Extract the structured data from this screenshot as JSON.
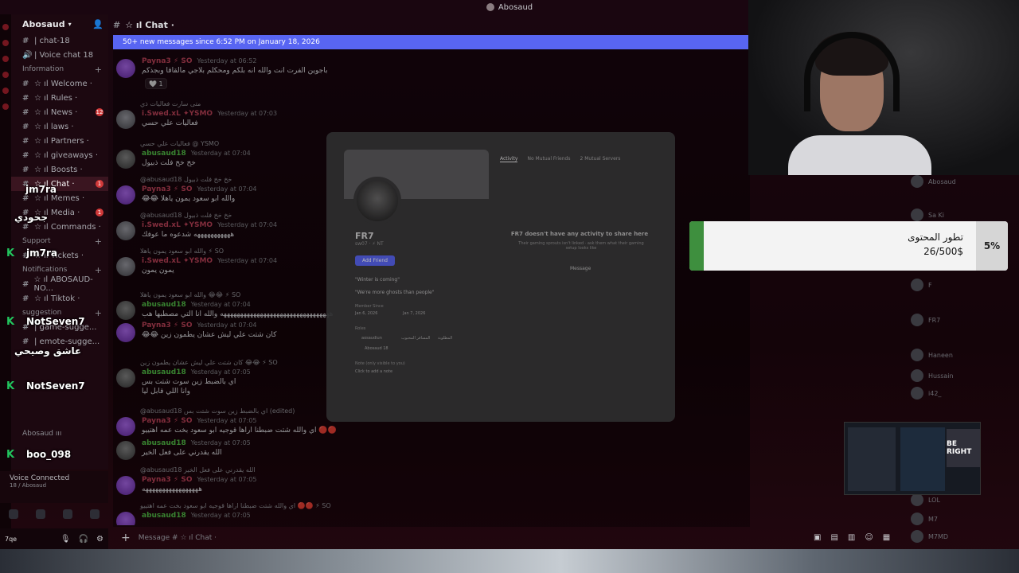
{
  "window": {
    "title": "Abosaud"
  },
  "server": {
    "name": "Abosaud"
  },
  "sidebar": {
    "items": [
      {
        "type": "channel",
        "label": "| chat-18"
      },
      {
        "type": "voice",
        "label": "| Voice chat 18"
      },
      {
        "type": "category",
        "label": "Information"
      },
      {
        "type": "channel",
        "label": "☆ ıl Welcome ·"
      },
      {
        "type": "channel",
        "label": "☆ ıl Rules ·"
      },
      {
        "type": "channel",
        "label": "☆ ıl News ·",
        "badge": "12"
      },
      {
        "type": "channel",
        "label": "☆ ıl laws ·"
      },
      {
        "type": "channel",
        "label": "☆ ıl Partners ·"
      },
      {
        "type": "channel",
        "label": "☆ ıl giveaways ·"
      },
      {
        "type": "channel",
        "label": "☆ ıl Boosts ·"
      },
      {
        "type": "channel",
        "label": "☆ ıl Chat ·",
        "active": true,
        "badge": "1"
      },
      {
        "type": "channel",
        "label": "☆ ıl Memes ·"
      },
      {
        "type": "channel",
        "label": "☆ ıl Media ·",
        "badge": "1"
      },
      {
        "type": "channel",
        "label": "☆ ıl Commands ·"
      },
      {
        "type": "category",
        "label": "Support"
      },
      {
        "type": "channel",
        "label": "☆ ıl Tickets ·"
      },
      {
        "type": "category",
        "label": "Notifications"
      },
      {
        "type": "channel",
        "label": "☆ ıl ABOSAUD-NO..."
      },
      {
        "type": "channel",
        "label": "☆ ıl Tiktok ·"
      },
      {
        "type": "category",
        "label": "suggestion"
      },
      {
        "type": "channel",
        "label": "| game-sugge..."
      },
      {
        "type": "channel",
        "label": "| emote-sugge..."
      }
    ],
    "overlay_names": [
      "jm7ra",
      "جحودي",
      "jm7ra",
      "NotSeven7",
      "عاشق وصيحي",
      "NotSeven7",
      "boo_098"
    ],
    "voice_channel_label": "Abosaud ııı"
  },
  "voice": {
    "status": "Voice Connected",
    "channel": "18 / Abosaud"
  },
  "user_panel": {
    "name": "7qe"
  },
  "chat": {
    "channel_name": "☆ ıl Chat ·",
    "new_messages_bar": "50+ new messages since 6:52 PM on January 18, 2026",
    "composer_placeholder": "Message # ☆ ıl Chat ·"
  },
  "messages": [
    {
      "reply": "",
      "user": "Payna3 ⚡ SO",
      "user_color": "red",
      "time": "Yesterday at 06:52",
      "text": "باجوين الفرت انت والله انه بلكم ومحكلم بلاجي مالقاقا وبجذكم",
      "avatar": "purple",
      "reaction": "🤍 1"
    },
    {
      "reply": "متى سارت فعاليات ذي",
      "user": "i.Swed.xL ✦YSMO",
      "user_color": "red",
      "time": "Yesterday at 07:03",
      "text": "فعاليات علي حسي",
      "avatar": "grey"
    },
    {
      "reply": "فعاليات علي حسي @ YSMO",
      "user": "abusaud18",
      "user_color": "green",
      "time": "Yesterday at 07:04",
      "text": "خخ خخ فلت ذبيول",
      "avatar": "dark"
    },
    {
      "reply": "@abusaud18 خخ خخ فلت ذبيول",
      "user": "Payna3 ⚡ SO",
      "user_color": "red",
      "time": "Yesterday at 07:04",
      "text": "😂😂 والله ابو سعود يمون ياهلا",
      "avatar": "purple"
    },
    {
      "reply": "@abusaud18 خخ خخ فلت ذبيول",
      "user": "i.Swed.xL ✦YSMO",
      "user_color": "red",
      "time": "Yesterday at 07:04",
      "text": "هههههههههههه شدعوه ما عوفك",
      "avatar": "grey"
    },
    {
      "reply": "والله ابو سعود يمون ياهلا ⚡ SO",
      "user": "i.Swed.xL ✦YSMO",
      "user_color": "red",
      "time": "Yesterday at 07:04",
      "text": "يمون يمون",
      "avatar": "grey"
    },
    {
      "reply": "والله ابو سعود يمون ياهلا 😂😂 ⚡ SO",
      "user": "abusaud18",
      "user_color": "green",
      "time": "Yesterday at 07:04",
      "text": "هههههههههههههههههههههههههههههههههه والله انا التي مصطبها هب",
      "avatar": "dark"
    },
    {
      "reply": "",
      "user": "Payna3 ⚡ SO",
      "user_color": "red",
      "time": "Yesterday at 07:04",
      "text": "😂😂 كان شتت علي ليش عشان يطمون زين",
      "avatar": "purple"
    },
    {
      "reply": "كان شتت علي ليش عشان يطمون زين 😂😂 ⚡ SO",
      "user": "abusaud18",
      "user_color": "green",
      "time": "Yesterday at 07:05",
      "text": "اي بالضبط زين سوت شتت بس",
      "text2": "وانا اللي قابل ليا",
      "avatar": "dark"
    },
    {
      "reply": "@abusaud18 اي بالضبط زين سوت شتت بس (edited)",
      "user": "Payna3 ⚡ SO",
      "user_color": "red",
      "time": "Yesterday at 07:05",
      "text": "اي والله شتت ضبطنا اراها قوجيه ابو سعود بخت عمه اهتييو 🔴🔴",
      "avatar": "purple"
    },
    {
      "reply": "",
      "user": "abusaud18",
      "user_color": "green",
      "time": "Yesterday at 07:05",
      "text": "الله يقدرني على فعل الخير",
      "avatar": "dark"
    },
    {
      "reply": "@abusaud18 الله يقدرني على فعل الخير",
      "user": "Payna3 ⚡ SO",
      "user_color": "red",
      "time": "Yesterday at 07:05",
      "text": "هههههههههههههههههه",
      "avatar": "purple"
    },
    {
      "reply": "اي والله شتت ضبطنا اراها قوجيه ابو سعود بخت عمه اهتييو 🔴🔴 ⚡ SO",
      "user": "abusaud18",
      "user_color": "green",
      "time": "Yesterday at 07:05",
      "text": "",
      "avatar": "purple"
    }
  ],
  "profile": {
    "name": "FR7",
    "handle": "sw07 · ⚡ NT",
    "add_friend": "Add Friend",
    "quote1": "\"Winter is coming\"",
    "quote2": "\"We're more ghosts than people\"",
    "member_since_label": "Member Since",
    "member_since_1": "Jan 6, 2026",
    "member_since_2": "Jan 7, 2026",
    "roles_label": "Roles",
    "roles": [
      "aosaudiun",
      "المسافر المحبوب",
      "المطلوبة",
      "Abosaud 18"
    ],
    "note_label": "Note (only visible to you)",
    "note_placeholder": "Click to add a note",
    "tabs": [
      "Activity",
      "No Mutual Friends",
      "2 Mutual Servers"
    ],
    "no_activity": "FR7 doesn't have any activity to share here",
    "no_activity_sub": "Their gaming sprouts isn't linked · ask them what their gaming setup looks like",
    "message_btn": "Message"
  },
  "donation": {
    "title": "تطور المحتوى",
    "amount": "26/500$",
    "percent_label": "5%",
    "progress": 0.05,
    "fill_color": "#3e8f3e"
  },
  "members": [
    "Abosaud",
    "Sa Ki",
    "F",
    "FR7",
    "Haneen",
    "Hussain",
    "i42_",
    "LOL",
    "M7",
    "M7MD"
  ],
  "preview": {
    "text": "BE RIGHT"
  }
}
